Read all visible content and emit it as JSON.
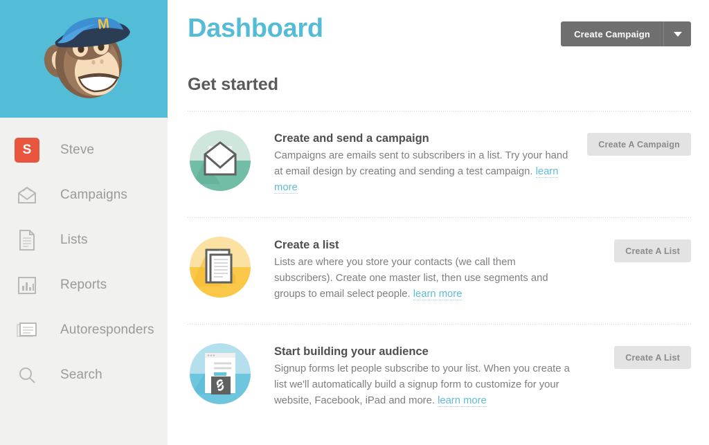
{
  "sidebar": {
    "logo": {
      "name": "mailchimp-freddie-logo",
      "background": "#53bdd7"
    },
    "items": [
      {
        "label": "Steve",
        "icon": "user-avatar-s",
        "avatar_letter": "S",
        "avatar_color": "#e8563f"
      },
      {
        "label": "Campaigns",
        "icon": "envelope-icon"
      },
      {
        "label": "Lists",
        "icon": "document-icon"
      },
      {
        "label": "Reports",
        "icon": "bar-chart-icon"
      },
      {
        "label": "Autoresponders",
        "icon": "stacked-windows-icon"
      },
      {
        "label": "Search",
        "icon": "search-icon"
      }
    ]
  },
  "header": {
    "title": "Dashboard",
    "title_color": "#55bcd8",
    "create_campaign_label": "Create Campaign",
    "dropdown_icon": "chevron-down-icon"
  },
  "main": {
    "section_title": "Get started",
    "cards": [
      {
        "icon": "envelope-circle-icon",
        "icon_colors": {
          "light": "#cfe6dd",
          "dark": "#72bda8"
        },
        "title": "Create and send a campaign",
        "text_before": "Campaigns are emails sent to subscribers in a list. Try your hand at email design by creating and sending a test campaign. ",
        "link_label": "learn more",
        "button_label": "Create A Campaign"
      },
      {
        "icon": "document-circle-icon",
        "icon_colors": {
          "light": "#fbe1a2",
          "dark": "#fbc748"
        },
        "title": "Create a list",
        "text_before": "Lists are where you store your contacts (we call them subscribers). Create one master list, then use segments and groups to email select people. ",
        "link_label": "learn more",
        "button_label": "Create A List"
      },
      {
        "icon": "signup-form-circle-icon",
        "icon_colors": {
          "light": "#b4e0ee",
          "dark": "#6ec5de"
        },
        "title": "Start building your audience",
        "text_before": "Signup forms let people subscribe to your list. When you create a list we'll automatically build a signup form to customize for your website, Facebook, iPad and more. ",
        "link_label": "learn more",
        "button_label": "Create A List"
      }
    ]
  }
}
